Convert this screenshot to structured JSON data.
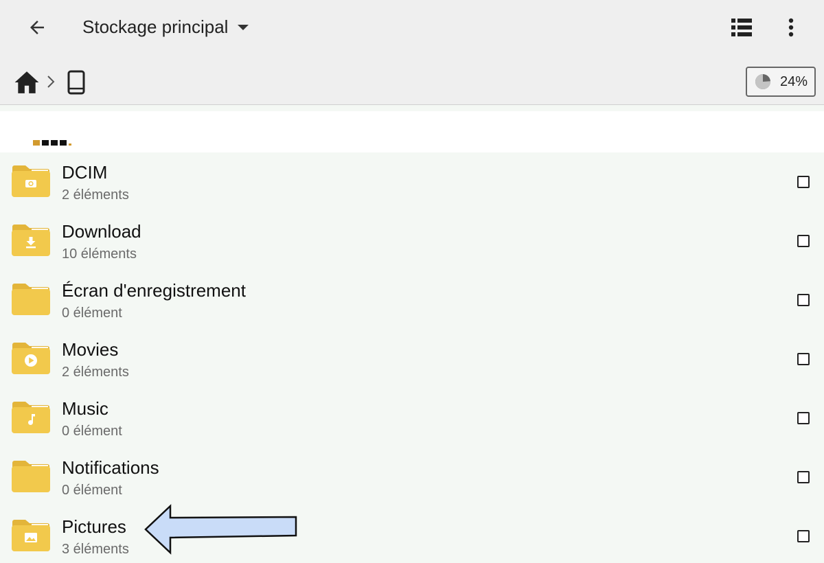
{
  "appbar": {
    "title": "Stockage principal",
    "icons": {
      "back": "arrow-left-icon",
      "dropdown": "caret-down-icon",
      "view": "list-view-icon",
      "more": "more-vertical-icon"
    }
  },
  "breadcrumb": {
    "icons": [
      "home-icon",
      "chevron-right-icon",
      "phone-icon"
    ],
    "storage_used": "24%",
    "storage_used_fraction": 0.24
  },
  "colors": {
    "folder": "#f2c94c",
    "folder_dark": "#e3b53a",
    "arrow_fill": "#c9dcf8"
  },
  "folders": [
    {
      "name": "DCIM",
      "count": "2 éléments",
      "icon": "camera-icon"
    },
    {
      "name": "Download",
      "count": "10 éléments",
      "icon": "download-icon"
    },
    {
      "name": "Écran d'enregistrement",
      "count": "0 élément",
      "icon": ""
    },
    {
      "name": "Movies",
      "count": "2 éléments",
      "icon": "play-icon"
    },
    {
      "name": "Music",
      "count": "0 élément",
      "icon": "music-note-icon"
    },
    {
      "name": "Notifications",
      "count": "0 élément",
      "icon": ""
    },
    {
      "name": "Pictures",
      "count": "3 éléments",
      "icon": "image-icon"
    }
  ]
}
